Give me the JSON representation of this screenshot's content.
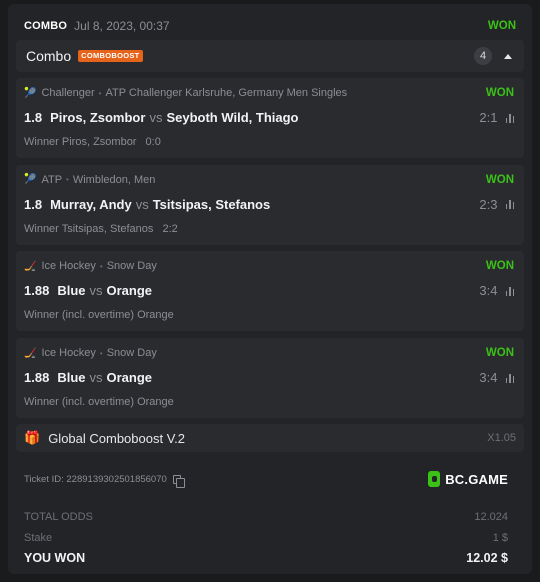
{
  "header": {
    "tag": "COMBO",
    "date": "Jul 8, 2023, 00:37",
    "status": "WON"
  },
  "combo": {
    "title": "Combo",
    "badge": "COMBOBOOST",
    "count": "4"
  },
  "bets": [
    {
      "sport_icon": "tennis-icon",
      "sport": "Challenger",
      "tournament": "ATP Challenger Karlsruhe, Germany Men Singles",
      "status": "WON",
      "odds": "1.8",
      "home": "Piros, Zsombor",
      "vs": "vs",
      "away": "Seyboth Wild, Thiago",
      "score": "2:1",
      "selection": "Winner Piros, Zsombor",
      "result": "0:0"
    },
    {
      "sport_icon": "tennis-icon",
      "sport": "ATP",
      "tournament": "Wimbledon, Men",
      "status": "WON",
      "odds": "1.8",
      "home": "Murray, Andy",
      "vs": "vs",
      "away": "Tsitsipas, Stefanos",
      "score": "2:3",
      "selection": "Winner Tsitsipas, Stefanos",
      "result": "2:2"
    },
    {
      "sport_icon": "ice-hockey-icon",
      "sport": "Ice Hockey",
      "tournament": "Snow Day",
      "status": "WON",
      "odds": "1.88",
      "home": "Blue",
      "vs": "vs",
      "away": "Orange",
      "score": "3:4",
      "selection": "Winner (incl. overtime) Orange",
      "result": ""
    },
    {
      "sport_icon": "ice-hockey-icon",
      "sport": "Ice Hockey",
      "tournament": "Snow Day",
      "status": "WON",
      "odds": "1.88",
      "home": "Blue",
      "vs": "vs",
      "away": "Orange",
      "score": "3:4",
      "selection": "Winner (incl. overtime) Orange",
      "result": ""
    }
  ],
  "boost": {
    "label": "Global Comboboost V.2",
    "multiplier": "X1.05"
  },
  "ticket": {
    "id": "Ticket ID: 2289139302501856070",
    "brand": "BC.GAME"
  },
  "totals": {
    "odds_label": "TOTAL ODDS",
    "odds_value": "12.024",
    "stake_label": "Stake",
    "stake_value": "1 $",
    "won_label": "YOU WON",
    "won_value": "12.02 $"
  },
  "colors": {
    "accent_green": "#3bc117",
    "boost_orange": "#e5631a",
    "background": "#1a1b1d",
    "card": "#232427"
  }
}
